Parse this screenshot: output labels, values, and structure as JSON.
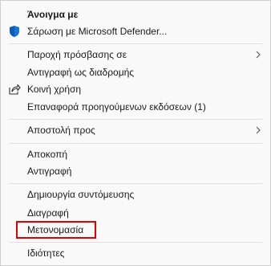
{
  "menu": {
    "open_with": "Άνοιγμα με",
    "scan": "Σάρωση με Microsoft Defender...",
    "give_access": "Παροχή πρόσβασης σε",
    "copy_path": "Αντιγραφή ως διαδρομής",
    "share": "Κοινή χρήση",
    "restore_versions": "Επαναφορά προηγούμενων εκδόσεων (1)",
    "send_to": "Αποστολή προς",
    "cut": "Αποκοπή",
    "copy": "Αντιγραφή",
    "create_shortcut": "Δημιουργία συντόμευσης",
    "delete": "Διαγραφή",
    "rename": "Μετονομασία",
    "properties": "Ιδιότητες"
  },
  "icons": {
    "defender": "shield-icon",
    "share": "share-icon",
    "submenu": "chevron-right-icon"
  },
  "colors": {
    "highlight_border": "#e00000",
    "shield_blue": "#1a73d9"
  }
}
